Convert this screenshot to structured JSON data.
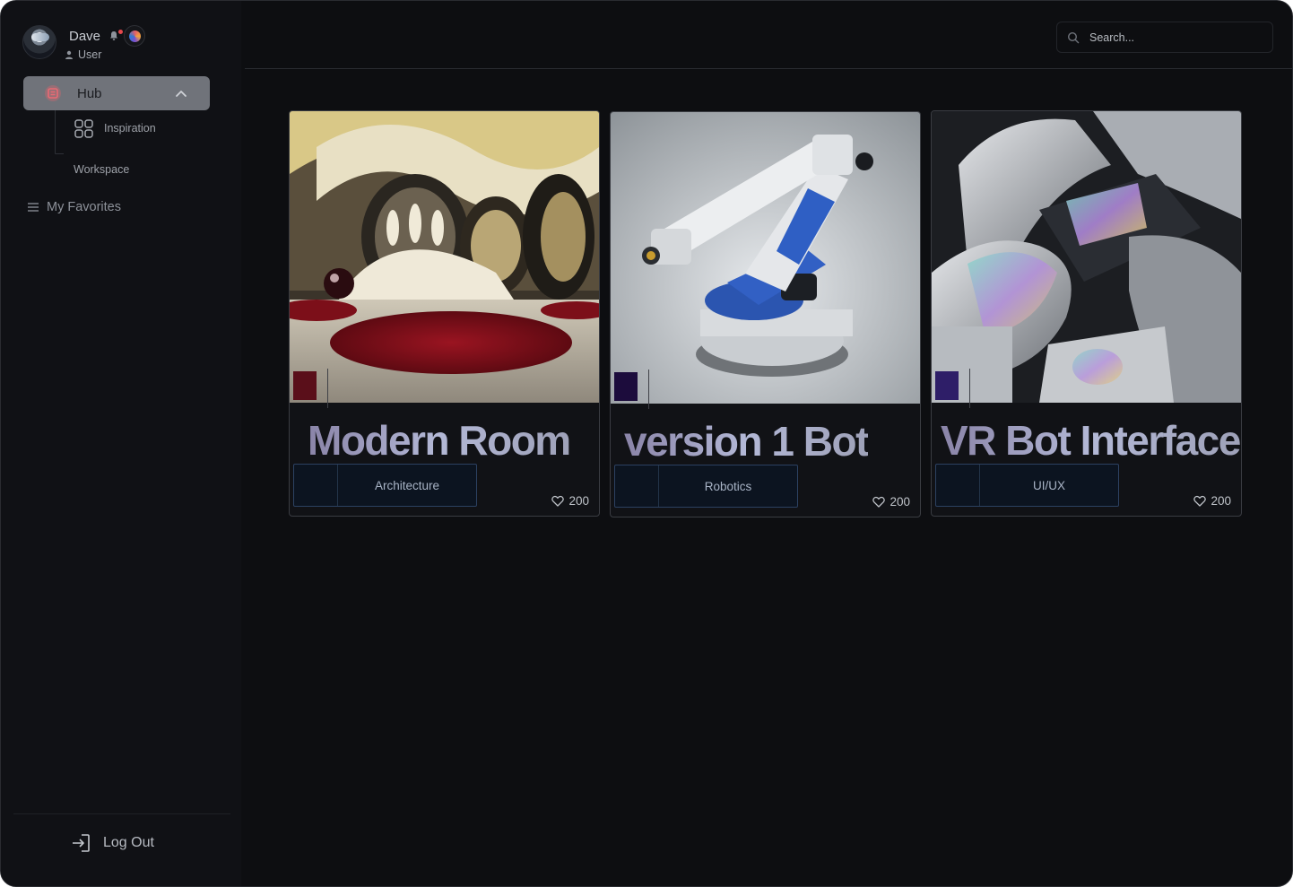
{
  "user": {
    "name": "Dave",
    "role": "User"
  },
  "nav": {
    "hub_label": "Hub",
    "sub_items": [
      {
        "label": "Inspiration",
        "icon": "grid-icon"
      },
      {
        "label": "Workspace"
      }
    ],
    "favorites_label": "My Favorites",
    "logout_label": "Log Out"
  },
  "search": {
    "placeholder": "Search..."
  },
  "cards": [
    {
      "title": "Modern Room",
      "tag": "Architecture",
      "likes": "200",
      "swatch_color": "#5a0f1a"
    },
    {
      "title": "version 1 Bot",
      "tag": "Robotics",
      "likes": "200",
      "swatch_color": "#1c0c3c"
    },
    {
      "title": "VR Bot Interface",
      "tag": "UI/UX",
      "likes": "200",
      "swatch_color": "#2e1e68"
    }
  ],
  "colors": {
    "background": "#0d0e11",
    "sidebar": "#101115",
    "hub_active": "#70737a",
    "tag_border": "#2c4161",
    "notification_dot": "#e5484d"
  }
}
